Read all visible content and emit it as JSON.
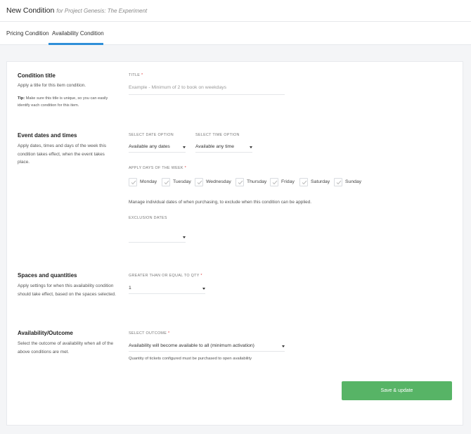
{
  "header": {
    "title": "New Condition",
    "subtitle": "for Project Genesis: The Experiment"
  },
  "tabs": [
    {
      "label": "Pricing Condition",
      "active": false
    },
    {
      "label": "Availability Condition",
      "active": true
    }
  ],
  "sections": {
    "condition_title": {
      "title": "Condition title",
      "description": "Apply a title for this item condition.",
      "tip_label": "Tip:",
      "tip_text": "Make sure this title is unique, so you can easily identify each condition for this item.",
      "field_label": "TITLE",
      "field_placeholder": "Example - Minimum of 2 to book on weekdays"
    },
    "event_dates": {
      "title": "Event dates and times",
      "description": "Apply dates, times and days of the week this condition takes effect, when the event takes place.",
      "date_option_label": "SELECT DATE OPTION",
      "date_option_value": "Available any dates",
      "time_option_label": "SELECT TIME OPTION",
      "time_option_value": "Available any time",
      "days_label": "APPLY DAYS OF THE WEEK",
      "days": [
        "Monday",
        "Tuesday",
        "Wednesday",
        "Thursday",
        "Friday",
        "Saturday",
        "Sunday"
      ],
      "manage_note": "Manage individual dates of when purchasing, to exclude when this condition can be applied.",
      "exclusion_label": "EXCLUSION DATES",
      "exclusion_value": ""
    },
    "spaces": {
      "title": "Spaces and quantities",
      "description": "Apply settings for when this availability condition should take effect, based on the spaces selected.",
      "qty_label": "GREATER THAN OR EQUAL TO QTY",
      "qty_value": "1"
    },
    "outcome": {
      "title": "Availability/Outcome",
      "description": "Select the outcome of availability when all of the above conditions are met.",
      "outcome_label": "SELECT OUTCOME",
      "outcome_value": "Availability will become available to all (minimum activation)",
      "outcome_note": "Quantity of tickets configured must be purchased to open availability"
    }
  },
  "required_marker": "*",
  "save_button": "Save & update",
  "colors": {
    "accent": "#2f8fd8",
    "save": "#57b466",
    "required": "#e03a3a"
  }
}
